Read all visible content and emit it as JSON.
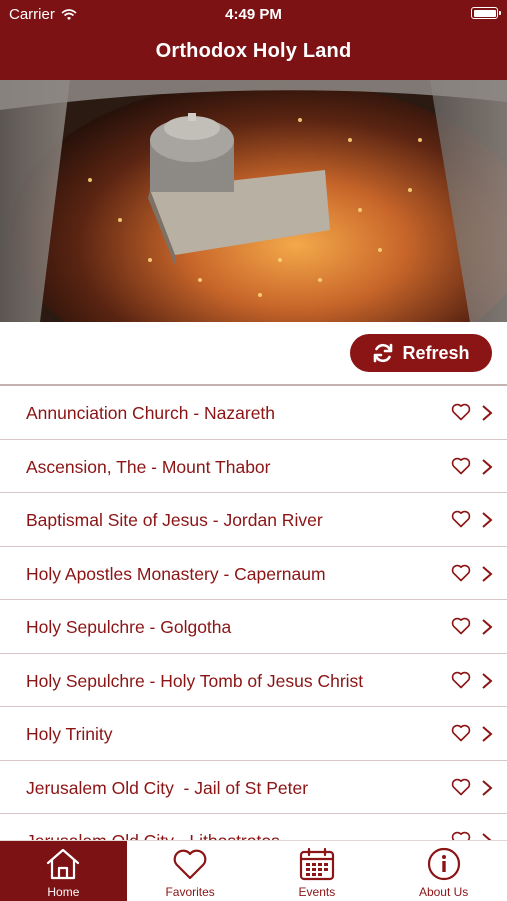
{
  "status_bar": {
    "carrier": "Carrier",
    "time": "4:49 PM"
  },
  "header": {
    "title": "Orthodox Holy Land"
  },
  "hero": {
    "icon": "church-photo"
  },
  "refresh": {
    "label": "Refresh",
    "icon": "refresh-icon"
  },
  "list": {
    "items": [
      {
        "label": "Annunciation Church - Nazareth"
      },
      {
        "label": "Ascension, The - Mount Thabor"
      },
      {
        "label": "Baptismal Site of Jesus - Jordan River"
      },
      {
        "label": "Holy Apostles Monastery - Capernaum"
      },
      {
        "label": "Holy Sepulchre - Golgotha"
      },
      {
        "label": "Holy Sepulchre - Holy Tomb of Jesus Christ"
      },
      {
        "label": "Holy Trinity"
      },
      {
        "label": "Jerusalem Old City  - Jail of St Peter"
      },
      {
        "label": "Jerusalem Old City - Lithostrotos"
      }
    ]
  },
  "tabs": [
    {
      "label": "Home",
      "icon": "home-icon",
      "active": true
    },
    {
      "label": "Favorites",
      "icon": "heart-icon",
      "active": false
    },
    {
      "label": "Events",
      "icon": "calendar-icon",
      "active": false
    },
    {
      "label": "About Us",
      "icon": "info-icon",
      "active": false
    }
  ],
  "colors": {
    "brand": "#7d1214",
    "accent": "#8b1415"
  }
}
